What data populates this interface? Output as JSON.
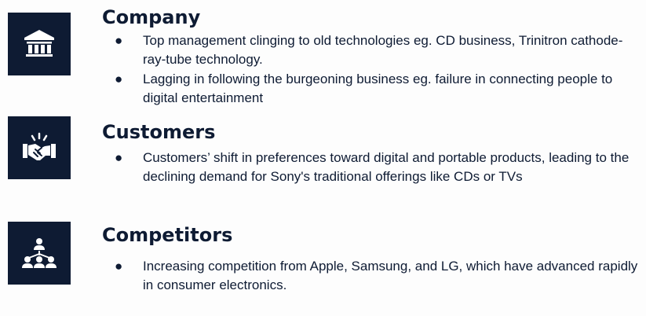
{
  "sections": [
    {
      "icon": "bank-icon",
      "heading": "Company",
      "bullets": [
        "Top management clinging to old technologies eg. CD business, Trinitron cathode-ray-tube technology.",
        "Lagging in following the burgeoning business eg. failure in connecting people to digital entertainment"
      ]
    },
    {
      "icon": "handshake-icon",
      "heading": "Customers",
      "bullets": [
        "Customers’ shift in preferences toward digital and portable products, leading to the declining demand for Sony's traditional offerings like CDs or TVs"
      ]
    },
    {
      "icon": "group-network-icon",
      "heading": "Competitors",
      "bullets": [
        "Increasing competition from Apple, Samsung, and LG, which have advanced rapidly in consumer electronics."
      ]
    }
  ],
  "bullet_glyph": "●",
  "colors": {
    "primary": "#0e1b33",
    "background": "#fdfdfd",
    "icon_fg": "#ffffff"
  }
}
